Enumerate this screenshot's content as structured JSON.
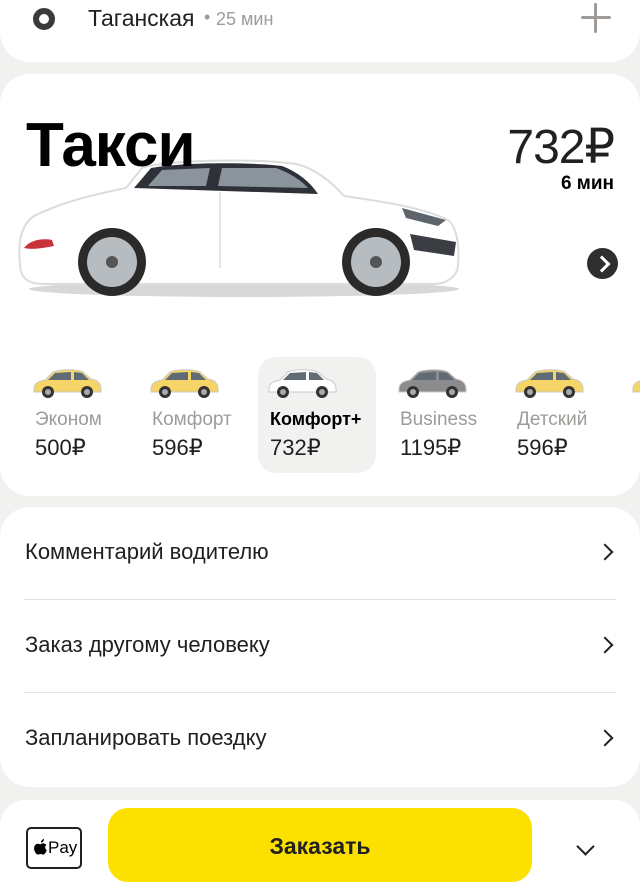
{
  "destination": {
    "name": "Таганская",
    "separator": "•",
    "time": "25 мин"
  },
  "tariff": {
    "title": "Такси",
    "price": "732₽",
    "eta": "6 мин"
  },
  "classes": [
    {
      "name": "Эконом",
      "price": "500₽",
      "car_color": "#f5d468"
    },
    {
      "name": "Комфорт",
      "price": "596₽",
      "car_color": "#f5d468"
    },
    {
      "name": "Комфорт+",
      "price": "732₽",
      "car_color": "#ffffff",
      "selected": true
    },
    {
      "name": "Business",
      "price": "1195₽",
      "car_color": "#8c8c8e"
    },
    {
      "name": "Детский",
      "price": "596₽",
      "car_color": "#f5d468"
    },
    {
      "name": "",
      "price": "",
      "car_color": "#f5d468"
    }
  ],
  "options": [
    {
      "label": "Комментарий водителю"
    },
    {
      "label": "Заказ другому человеку"
    },
    {
      "label": "Запланировать поездку"
    }
  ],
  "bottom": {
    "pay_label": "Pay",
    "order_label": "Заказать"
  },
  "colors": {
    "accent": "#fce000",
    "background": "#f1f1f0"
  }
}
